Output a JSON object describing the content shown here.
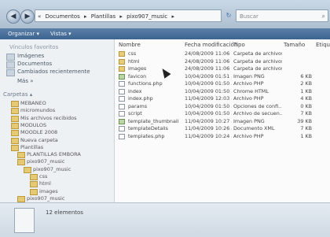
{
  "address": {
    "crumbs": [
      "Documentos",
      "Plantillas",
      "pixo907_music"
    ],
    "search_placeholder": "Buscar"
  },
  "toolbar": {
    "organize": "Organizar",
    "views": "Vistas"
  },
  "nav": {
    "favorites": [
      "Vínculos favoritos",
      "Imágenes",
      "Documentos",
      "Cambiados recientemente",
      "Más"
    ],
    "folders_header": "Carpetas",
    "tree": [
      {
        "label": "MEBANEO",
        "level": 1
      },
      {
        "label": "micromundos",
        "level": 1
      },
      {
        "label": "Mis archivos recibidos",
        "level": 1
      },
      {
        "label": "MODULOS",
        "level": 1
      },
      {
        "label": "MOODLE 2008",
        "level": 1
      },
      {
        "label": "Nueva carpeta",
        "level": 1
      },
      {
        "label": "Plantillas",
        "level": 1
      },
      {
        "label": "PLANTILLAS EMBORA",
        "level": 2
      },
      {
        "label": "pixo907_music",
        "level": 2
      },
      {
        "label": "pixo907_music",
        "level": 3
      },
      {
        "label": "css",
        "level": 4
      },
      {
        "label": "html",
        "level": 4
      },
      {
        "label": "images",
        "level": 4
      },
      {
        "label": "pixo907_music",
        "level": 2
      }
    ]
  },
  "columns": {
    "name": "Nombre",
    "date": "Fecha modificación",
    "type": "Tipo",
    "size": "Tamaño",
    "tags": "Etique"
  },
  "files": [
    {
      "name": "css",
      "date": "24/08/2009 11:06 ...",
      "type": "Carpeta de archivos",
      "size": "",
      "icon": "folder"
    },
    {
      "name": "html",
      "date": "24/08/2009 11:06 ...",
      "type": "Carpeta de archivos",
      "size": "",
      "icon": "folder"
    },
    {
      "name": "images",
      "date": "24/08/2009 11:06 ...",
      "type": "Carpeta de archivos",
      "size": "",
      "icon": "folder"
    },
    {
      "name": "favicon",
      "date": "10/04/2009 01:51 a...",
      "type": "Imagen PNG",
      "size": "6 KB",
      "icon": "png"
    },
    {
      "name": "functions.php",
      "date": "10/04/2009 01:50 a...",
      "type": "Archivo PHP",
      "size": "2 KB",
      "icon": "file"
    },
    {
      "name": "index",
      "date": "10/04/2009 01:50 a...",
      "type": "Chrome HTML",
      "size": "1 KB",
      "icon": "file"
    },
    {
      "name": "index.php",
      "date": "11/04/2009 12:03 a...",
      "type": "Archivo PHP",
      "size": "4 KB",
      "icon": "file"
    },
    {
      "name": "params",
      "date": "10/04/2009 01:50 a...",
      "type": "Opciones de confi...",
      "size": "0 KB",
      "icon": "file"
    },
    {
      "name": "script",
      "date": "10/04/2009 01:50 a...",
      "type": "Archivo de secuen...",
      "size": "7 KB",
      "icon": "file"
    },
    {
      "name": "template_thumbnail",
      "date": "11/04/2009 10:27 a...",
      "type": "Imagen PNG",
      "size": "39 KB",
      "icon": "png"
    },
    {
      "name": "templateDetails",
      "date": "11/04/2009 10:26 a...",
      "type": "Documento XML",
      "size": "7 KB",
      "icon": "file"
    },
    {
      "name": "templates.php",
      "date": "11/04/2009 10:24 a...",
      "type": "Archivo PHP",
      "size": "1 KB",
      "icon": "file"
    }
  ],
  "status": {
    "count": "12 elementos"
  }
}
